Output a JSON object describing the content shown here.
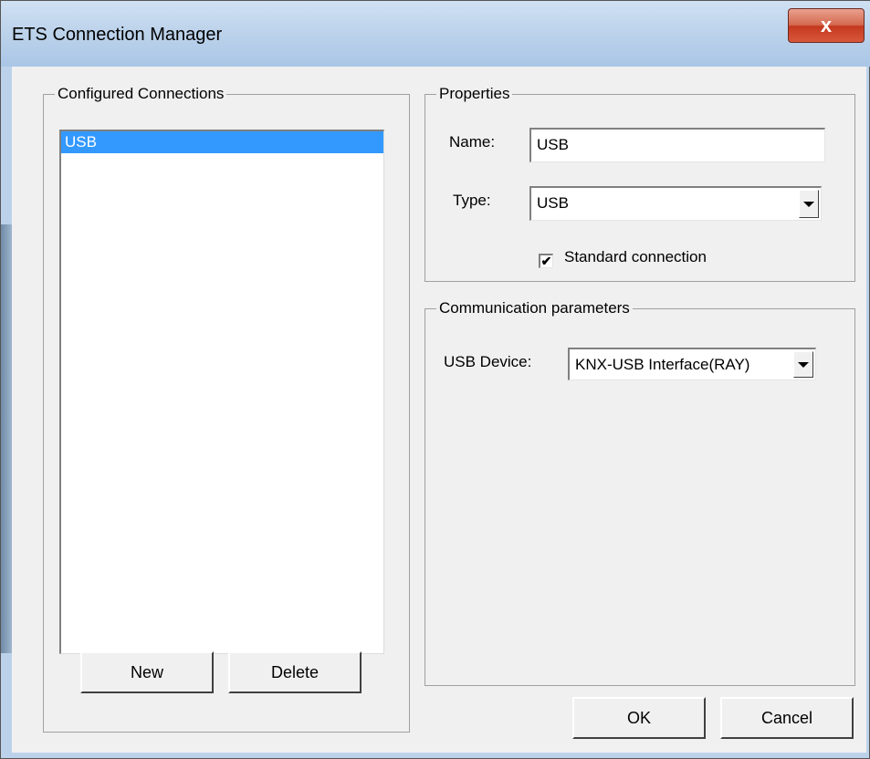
{
  "window": {
    "title": "ETS Connection Manager",
    "close_icon": "x-close-icon",
    "close_label": "x"
  },
  "configured": {
    "legend": "Configured Connections",
    "items": [
      "USB"
    ],
    "selected_index": 0,
    "new_label": "New",
    "delete_label": "Delete"
  },
  "properties": {
    "legend": "Properties",
    "name_label": "Name:",
    "name_value": "USB",
    "type_label": "Type:",
    "type_value": "USB",
    "standard_label": "Standard connection",
    "standard_checked": true,
    "check_mark": "✔"
  },
  "communication": {
    "legend": "Communication parameters",
    "usb_label": "USB Device:",
    "usb_value": "KNX-USB Interface(RAY)"
  },
  "footer": {
    "ok_label": "OK",
    "cancel_label": "Cancel"
  },
  "colors": {
    "selection": "#3399ff",
    "title_bar": "#bad1ea",
    "close_button": "#c4391f"
  }
}
